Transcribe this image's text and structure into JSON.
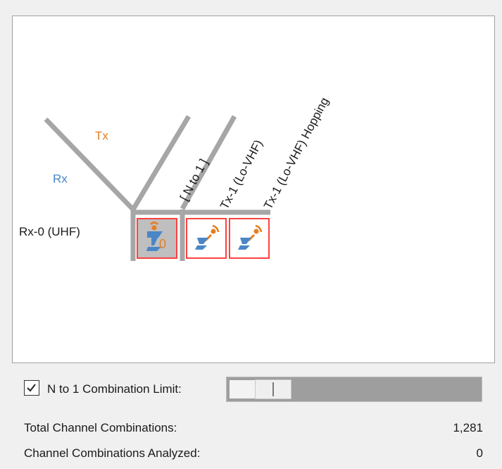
{
  "matrix": {
    "tx_header": "Tx",
    "rx_header": "Rx",
    "columns": [
      {
        "label": "[ N to 1 ]"
      },
      {
        "label": "Tx-1 (Lo-VHF)"
      },
      {
        "label": "Tx-1 (Lo-VHF) Hopping"
      }
    ],
    "rows": [
      {
        "label": "Rx-0 (UHF)"
      }
    ],
    "cells": [
      {
        "icon": "n-to-1-combination-icon",
        "count": "0",
        "selected": true
      },
      {
        "icon": "tx-rx-link-icon",
        "selected": false
      },
      {
        "icon": "tx-rx-link-icon",
        "selected": false
      }
    ]
  },
  "limit": {
    "checked": true,
    "label": "N to 1 Combination Limit:",
    "slider_fraction": 0.12
  },
  "stats": {
    "total_label": "Total Channel Combinations:",
    "total_value": "1,281",
    "analyzed_label": "Channel Combinations Analyzed:",
    "analyzed_value": "0"
  },
  "colors": {
    "tx": "#e67e22",
    "rx": "#4a86c6",
    "cell_border": "#ff4040",
    "grid_line": "#a6a6a6",
    "selected_cell_bg": "#bfbfbf"
  }
}
